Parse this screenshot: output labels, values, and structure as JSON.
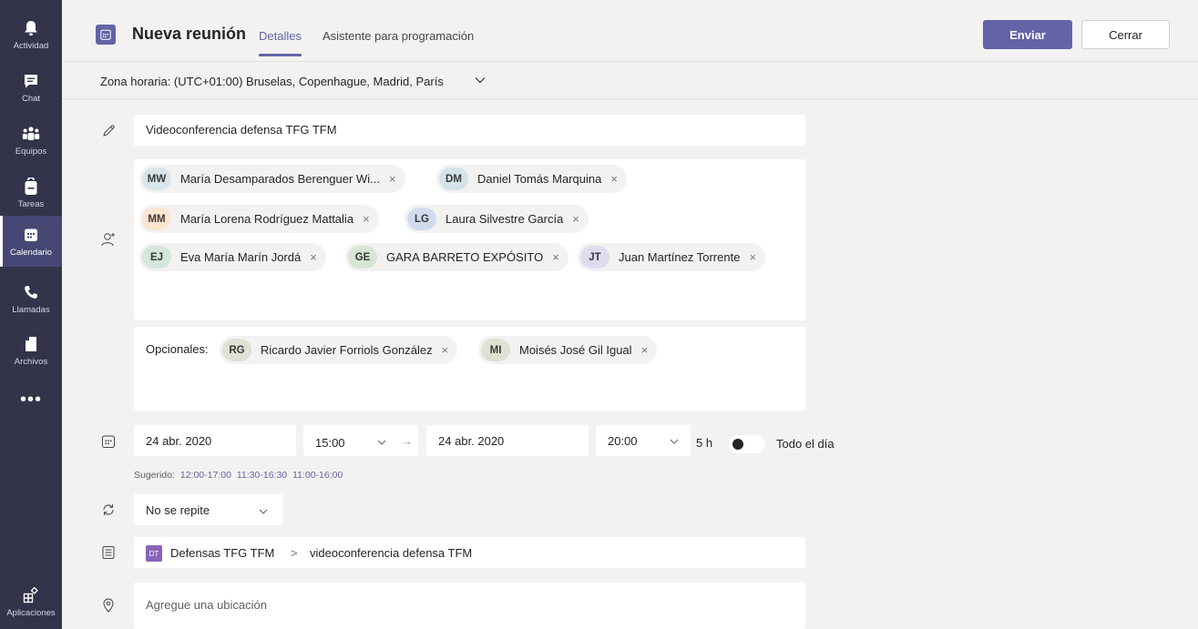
{
  "rail": {
    "items": [
      {
        "label": "Actividad",
        "icon": "bell-icon"
      },
      {
        "label": "Chat",
        "icon": "chat-icon"
      },
      {
        "label": "Equipos",
        "icon": "teams-icon"
      },
      {
        "label": "Tareas",
        "icon": "tasks-icon"
      },
      {
        "label": "Calendario",
        "icon": "calendar-icon",
        "active": true
      },
      {
        "label": "Llamadas",
        "icon": "phone-icon"
      },
      {
        "label": "Archivos",
        "icon": "files-icon"
      }
    ],
    "more": "•••",
    "apps_label": "Aplicaciones"
  },
  "header": {
    "title": "Nueva reunión",
    "tabs": [
      "Detalles",
      "Asistente para programación"
    ],
    "send_label": "Enviar",
    "close_label": "Cerrar"
  },
  "timezone": {
    "label": "Zona horaria: (UTC+01:00) Bruselas, Copenhague, Madrid, París"
  },
  "form": {
    "title_value": "Videoconferencia defensa TFG TFM",
    "attendees": [
      {
        "initials": "MW",
        "name": "María Desamparados Berenguer Wi...",
        "color": "#d8e6ea"
      },
      {
        "initials": "DM",
        "name": "Daniel Tomás Marquina",
        "color": "#d3e3ea"
      },
      {
        "initials": "MM",
        "name": "María Lorena Rodríguez Mattalia",
        "color": "#fde4cf"
      },
      {
        "initials": "LG",
        "name": "Laura Silvestre García",
        "color": "#d0dcee"
      },
      {
        "initials": "EJ",
        "name": "Eva María Marín Jordá",
        "color": "#d5e6db"
      },
      {
        "initials": "GE",
        "name": "GARA BARRETO EXPÓSITO",
        "color": "#d5e6d3"
      },
      {
        "initials": "JT",
        "name": "Juan Martínez Torrente",
        "color": "#e1dbef"
      }
    ],
    "remove_glyph": "×",
    "optional_label": "Opcionales:",
    "optional": [
      {
        "initials": "RG",
        "name": "Ricardo Javier Forriols González",
        "color": "#dde2d4"
      },
      {
        "initials": "MI",
        "name": "Moisés José Gil Igual",
        "color": "#dde2d4"
      }
    ],
    "start_date": "24 abr. 2020",
    "start_time": "15:00",
    "arrow": "→",
    "end_date": "24 abr. 2020",
    "end_time": "20:00",
    "duration": "5 h",
    "all_day_label": "Todo el día",
    "suggested_label": "Sugerido:",
    "suggested_slots": [
      "12:00-17:00",
      "11:30-16:30",
      "11:00-16:00"
    ],
    "repeat": "No se repite",
    "channel_badge": "DT",
    "channel_team": "Defensas TFG TFM",
    "channel_sep": ">",
    "channel_name": "videoconferencia defensa TFM",
    "location_placeholder": "Agregue una ubicación"
  }
}
